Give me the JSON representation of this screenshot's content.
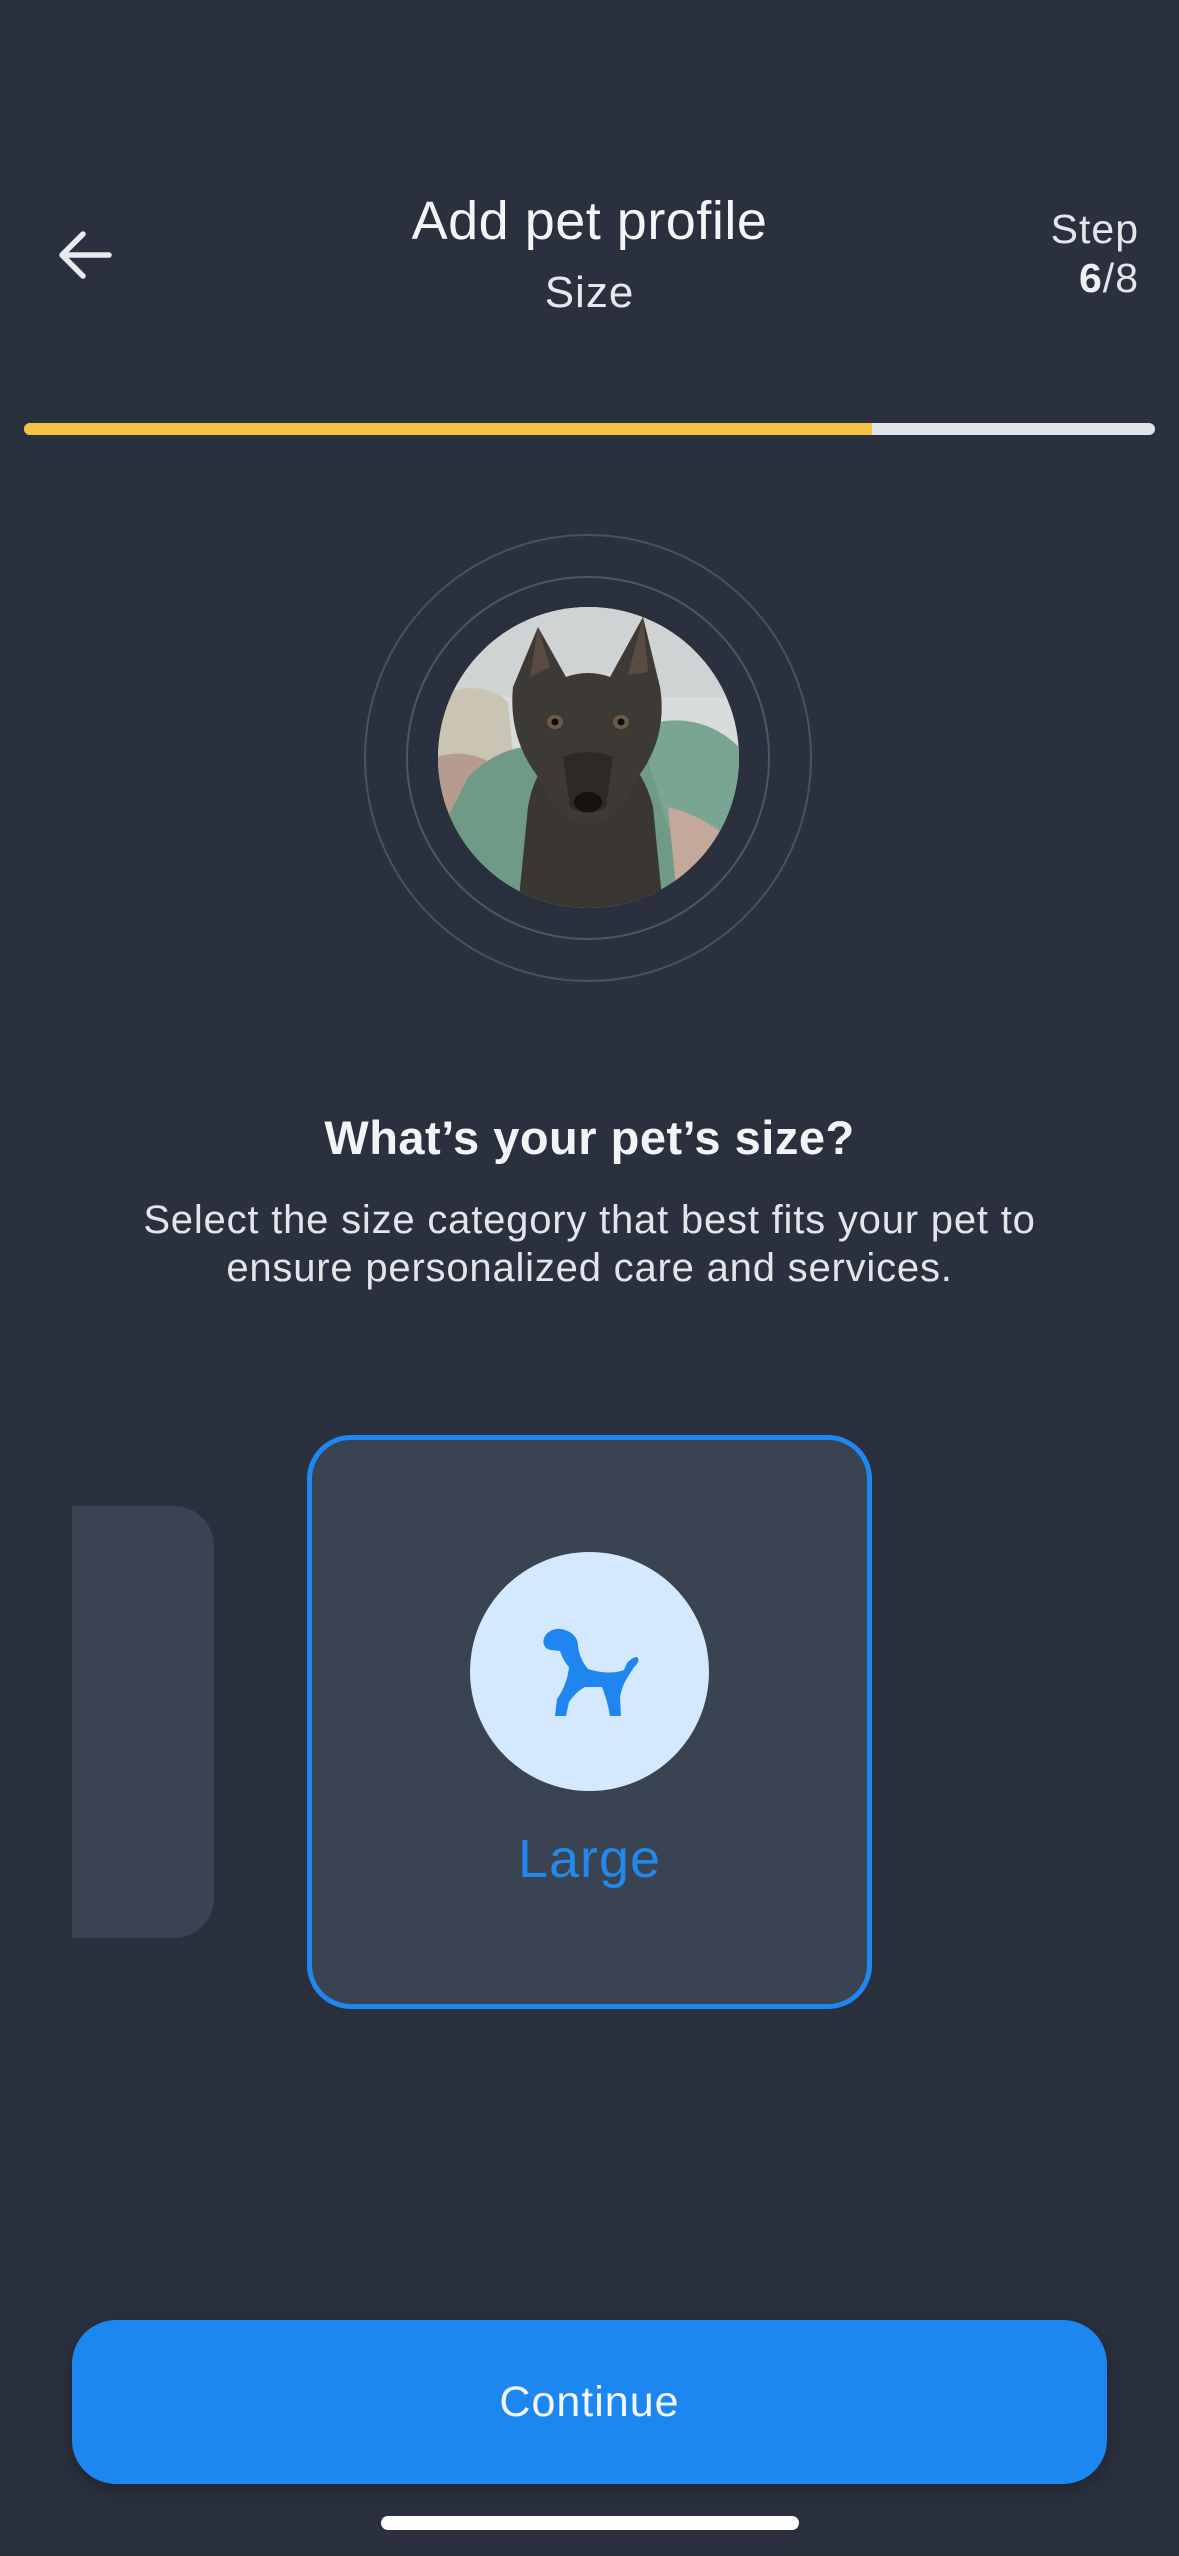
{
  "header": {
    "title": "Add pet profile",
    "subtitle": "Size",
    "step_label": "Step",
    "step_current": "6",
    "step_total": "/8"
  },
  "progress": {
    "fraction": 0.75,
    "fill_color": "#f5c242",
    "track_color": "#dfe3ea"
  },
  "avatar": {
    "icon": "pet-photo"
  },
  "question": {
    "title": "What’s your pet’s size?",
    "description": "Select the size category that best fits your pet to ensure personalized care and services."
  },
  "size_options": {
    "selected": {
      "label": "Large",
      "icon": "dog-icon"
    }
  },
  "footer": {
    "continue_label": "Continue"
  },
  "colors": {
    "background": "#2a303d",
    "accent": "#1d87f1",
    "card": "#394351",
    "icon_circle": "#d4e8ff"
  }
}
